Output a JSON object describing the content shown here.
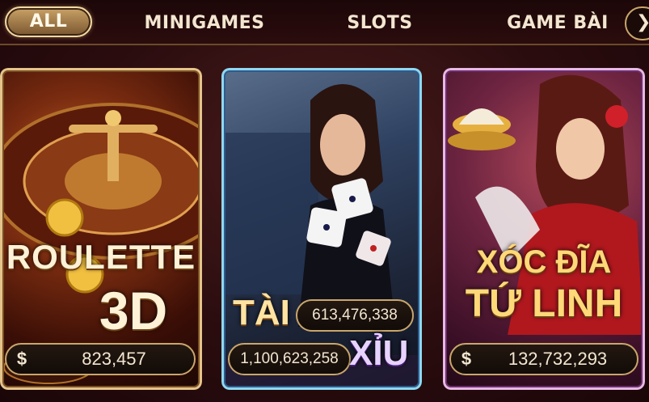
{
  "tabs": {
    "all": "ALL",
    "minigames": "MINIGAMES",
    "slots": "SLOTS",
    "gamebai": "GAME BÀI",
    "next_icon": "chevron-right-icon"
  },
  "cards": {
    "roulette": {
      "title_line1": "ROULETTE",
      "title_line2": "3D",
      "currency": "$",
      "jackpot": "823,457"
    },
    "taixiu": {
      "tai_label": "TÀI",
      "xiu_label": "XỈU",
      "tai_jackpot": "613,476,338",
      "xiu_jackpot": "1,100,623,258"
    },
    "xocdia": {
      "title_line1": "XÓC ĐĨA",
      "title_line2": "TỨ LINH",
      "currency": "$",
      "jackpot": "132,732,293"
    }
  },
  "colors": {
    "accent_gold": "#c9a66b",
    "background": "#2a0c0e"
  }
}
